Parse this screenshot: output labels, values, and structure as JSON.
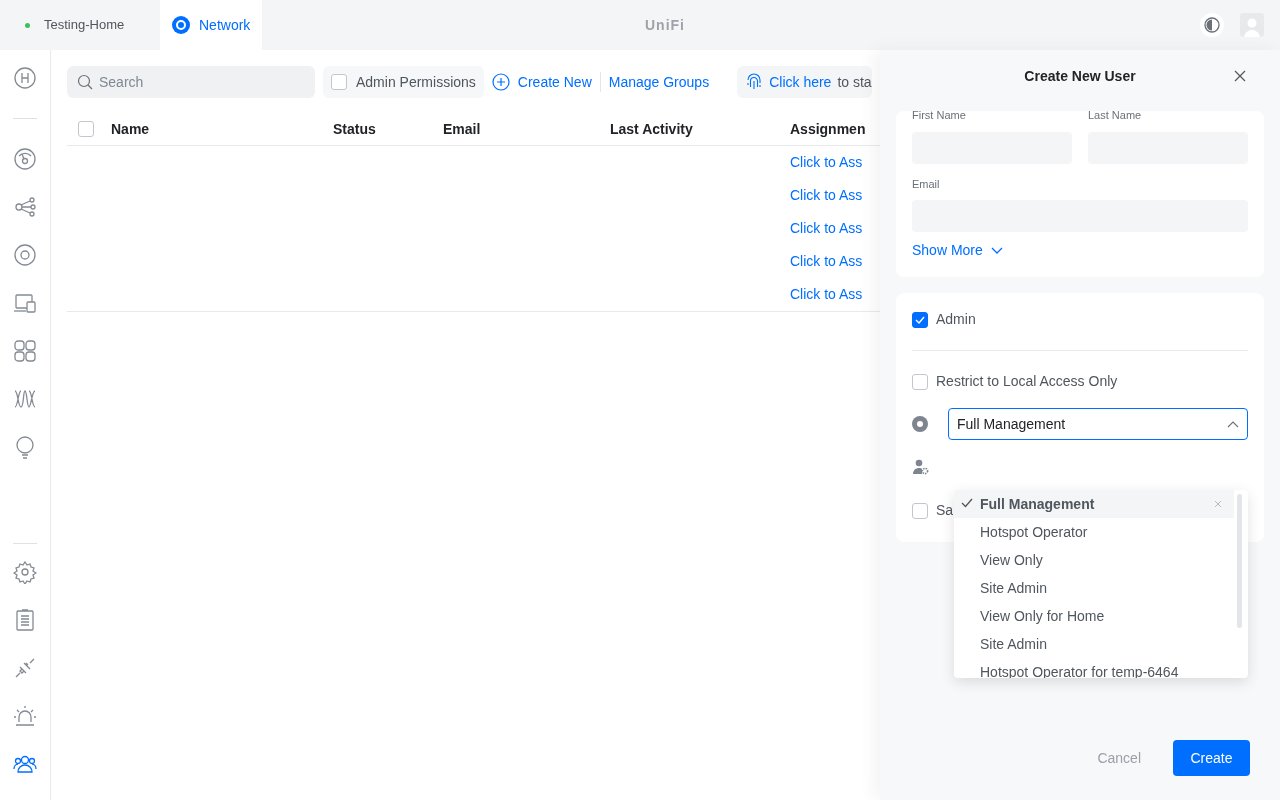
{
  "top_bar": {
    "site": {
      "name": "Testing-Home"
    },
    "app_tab": {
      "label": "Network",
      "selected": true
    },
    "logo": "UniFi"
  },
  "sidebar": {
    "items": [
      {
        "kind": "home",
        "selected": false
      },
      {
        "kind": "gauge",
        "selected": false
      },
      {
        "kind": "topology",
        "selected": false
      },
      {
        "kind": "target",
        "selected": false
      },
      {
        "kind": "devices",
        "selected": false
      },
      {
        "kind": "clients",
        "selected": false
      },
      {
        "kind": "wave",
        "selected": false
      },
      {
        "kind": "bulb",
        "selected": false
      }
    ],
    "bottom_items": [
      {
        "kind": "gear",
        "selected": false
      },
      {
        "kind": "list",
        "selected": false
      },
      {
        "kind": "plug",
        "selected": false
      },
      {
        "kind": "alarm",
        "selected": false
      },
      {
        "kind": "users",
        "selected": true
      }
    ]
  },
  "toolbar": {
    "search": {
      "placeholder": "Search"
    },
    "admin_permissions": {
      "label": "Admin Permissions",
      "checked": false
    },
    "create_new": "Create New",
    "manage_groups": "Manage Groups",
    "banner": {
      "link": "Click here",
      "text": "to sta"
    }
  },
  "table": {
    "select_all": {
      "checked": false
    },
    "columns": [
      "Name",
      "Status",
      "Email",
      "Last Activity",
      "Assignmen"
    ],
    "rows": [
      {
        "assignment": "Click to Ass"
      },
      {
        "assignment": "Click to Ass"
      },
      {
        "assignment": "Click to Ass"
      },
      {
        "assignment": "Click to Ass"
      },
      {
        "assignment": "Click to Ass"
      }
    ]
  },
  "panel": {
    "title": "Create New User",
    "fields": [
      {
        "label": "First Name"
      },
      {
        "label": "Last Name"
      },
      {
        "label": "Email"
      }
    ],
    "show_more": "Show More",
    "admin": {
      "label": "Admin",
      "checked": true
    },
    "restrict": {
      "label": "Restrict to Local Access Only",
      "checked": false
    },
    "role_select": {
      "value": "Full Management",
      "expanded": true,
      "options": [
        {
          "label": "Full Management",
          "selected": true
        },
        {
          "label": "Hotspot Operator",
          "selected": false
        },
        {
          "label": "View Only",
          "selected": false
        },
        {
          "label": "Site Admin",
          "selected": false
        },
        {
          "label": "View Only for Home",
          "selected": false
        },
        {
          "label": "Site Admin",
          "selected": false
        },
        {
          "label": "Hotspot Operator for temp-6464",
          "selected": false
        }
      ]
    },
    "extra_option": {
      "label": "Sa",
      "checked": false
    },
    "buttons": {
      "cancel": "Cancel",
      "create": "Create"
    }
  }
}
